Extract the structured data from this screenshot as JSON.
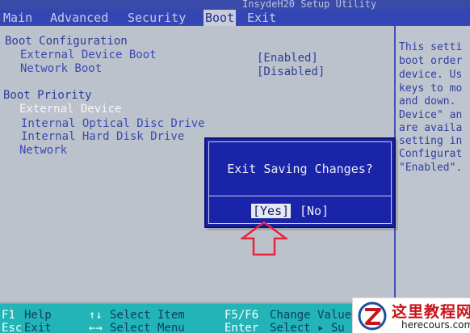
{
  "title": "InsydeH20 Setup Utility",
  "menu": [
    {
      "label": "Main",
      "active": false
    },
    {
      "label": "Advanced",
      "active": false
    },
    {
      "label": "Security",
      "active": false
    },
    {
      "label": "Boot",
      "active": true
    },
    {
      "label": "Exit",
      "active": false
    }
  ],
  "boot_config": {
    "heading": "Boot Configuration",
    "items": [
      {
        "label": "External Device Boot",
        "value": "[Enabled]"
      },
      {
        "label": "Network Boot",
        "value": "[Disabled]"
      }
    ]
  },
  "boot_priority": {
    "heading": "Boot Priority",
    "items": [
      "External Device",
      "Internal Optical Disc Drive",
      "Internal Hard Disk Drive",
      "Network"
    ]
  },
  "help_text": [
    "This setti",
    "boot order",
    "device. Us",
    "keys to mo",
    "and down.",
    "Device\" an",
    "are availa",
    "setting in",
    "Configurat",
    "\"Enabled\"."
  ],
  "dialog": {
    "message": "Exit Saving Changes?",
    "yes_label": "[Yes]",
    "no_label": "[No]",
    "selected": "yes"
  },
  "footer": {
    "row1": [
      {
        "key": "F1",
        "desc": "Help"
      },
      {
        "key": "↑↓",
        "desc": "Select Item"
      },
      {
        "key": "F5/F6",
        "desc": "Change Values"
      }
    ],
    "row2": [
      {
        "key": "Esc",
        "desc": "Exit"
      },
      {
        "key": "←→",
        "desc": "Select Menu"
      },
      {
        "key": "Enter",
        "desc": "Select ▸ Su"
      }
    ]
  },
  "watermark": {
    "text": "这里教程网",
    "url": "herecours.com"
  },
  "colors": {
    "menubar_bg": "#3446b4",
    "panel_bg": "#bcc2cc",
    "dialog_bg": "#1a24a8",
    "footer_bg": "#22b4b6",
    "arrow": "#e8253a"
  }
}
